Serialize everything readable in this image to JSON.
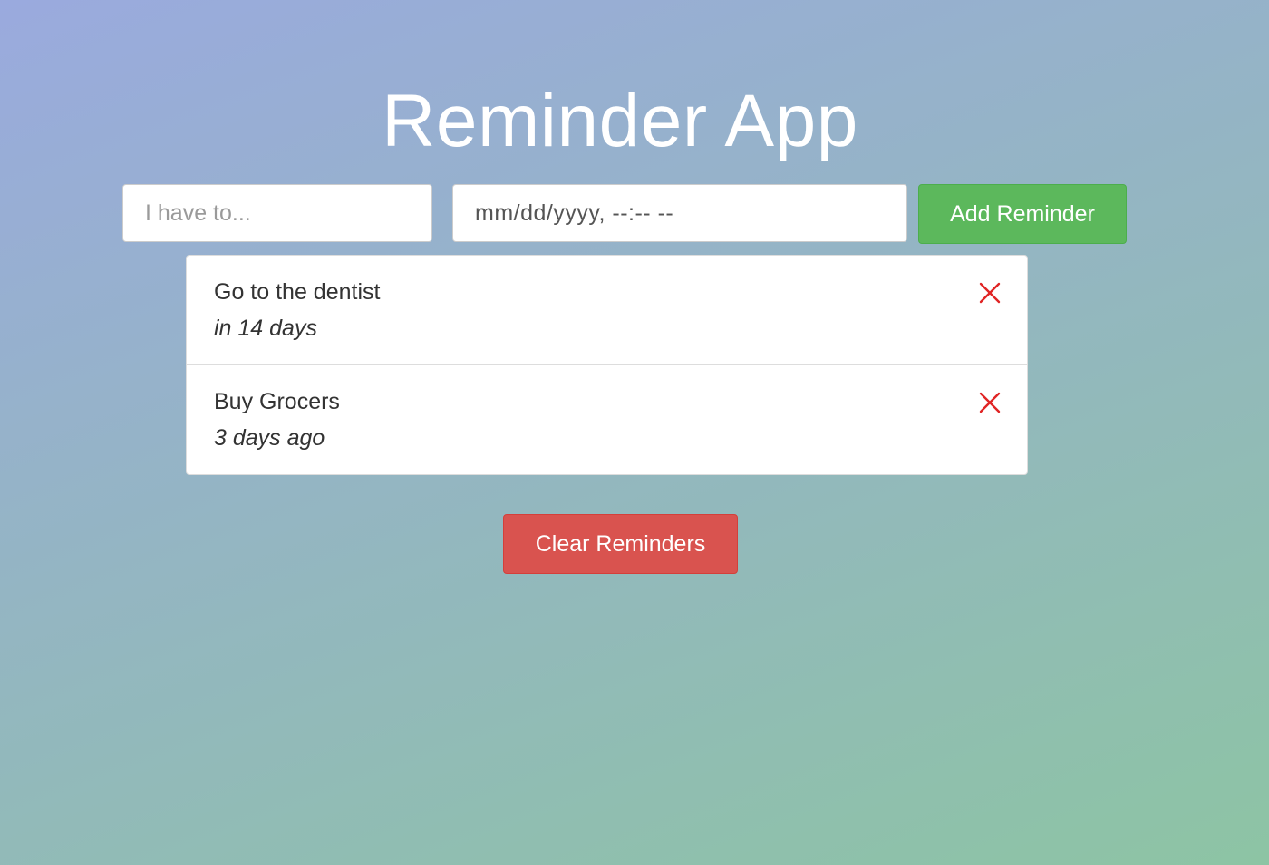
{
  "app": {
    "title": "Reminder App"
  },
  "form": {
    "text_placeholder": "I have to...",
    "text_value": "",
    "date_display": "mm/dd/yyyy, --:-- --",
    "add_label": "Add Reminder"
  },
  "reminders": [
    {
      "text": "Go to the dentist",
      "time": "in 14 days",
      "delete_icon": "close-icon"
    },
    {
      "text": "Buy Grocers",
      "time": "3 days ago",
      "delete_icon": "close-icon"
    }
  ],
  "clear_label": "Clear Reminders",
  "colors": {
    "add_button": "#5cb85c",
    "clear_button": "#d9534f",
    "delete_icon": "#e02424",
    "title": "#ffffff"
  }
}
